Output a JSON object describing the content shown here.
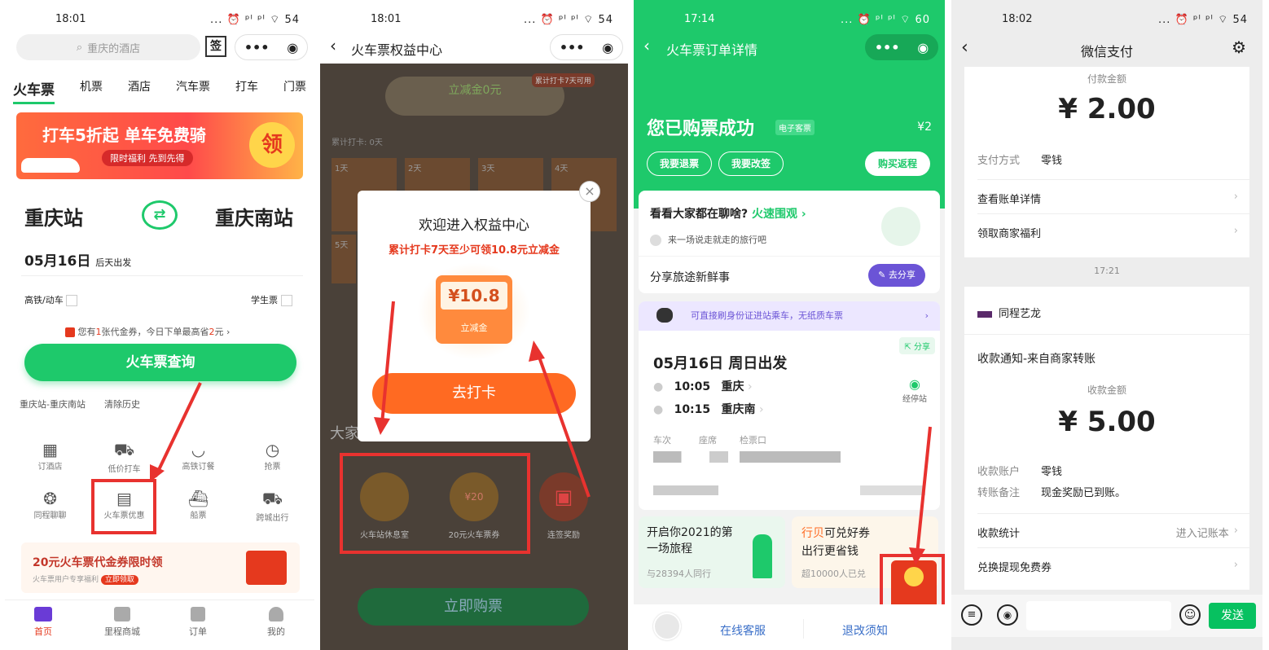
{
  "p1": {
    "time": "18:01",
    "status_icons": "... ⏰ ᵖᴵ ᵖᴵ ⌔ 54",
    "search_placeholder": "重庆的酒店",
    "sign_label": "签",
    "tabs": [
      "火车票",
      "机票",
      "酒店",
      "汽车票",
      "打车",
      "门票"
    ],
    "banner_text": "打车5折起 单车免费骑",
    "banner_sub": "限时福利 先到先得",
    "banner_badge": "领",
    "from": "重庆站",
    "to": "重庆南站",
    "date": "05月16日",
    "date_hint": "后天出发",
    "opt_gaotie": "高铁/动车",
    "opt_student": "学生票",
    "coupon_prefix": "您有",
    "coupon_count": "1",
    "coupon_mid": "张代金券，今日下单最高省",
    "coupon_amount": "2",
    "coupon_suffix": "元 ›",
    "query_button": "火车票查询",
    "history": "重庆站-重庆南站",
    "clear_history": "清除历史",
    "grid": [
      {
        "label": "订酒店"
      },
      {
        "label": "低价打车"
      },
      {
        "label": "高铁订餐"
      },
      {
        "label": "抢票"
      },
      {
        "label": "同程聊聊"
      },
      {
        "label": "火车票优惠"
      },
      {
        "label": "船票"
      },
      {
        "label": "跨城出行"
      }
    ],
    "promo_title": "20元火车票代金券限时领",
    "promo_sub": "火车票用户专享福利",
    "promo_btn": "立即领取",
    "nav": [
      "首页",
      "里程商城",
      "订单",
      "我的"
    ]
  },
  "p2": {
    "time": "18:01",
    "status_icons": "... ⏰ ᵖᴵ ᵖᴵ ⌔ 54",
    "title": "火车票权益中心",
    "bg_amount": "立减金0元",
    "bg_badge": "累计打卡7天可用",
    "bg_row": "累计打卡: 0天",
    "bg_days": [
      "1天",
      "2天",
      "3天",
      "4天",
      "5天"
    ],
    "bg_text": "大家",
    "bg_buy": "立即购票",
    "modal_title": "欢迎进入权益中心",
    "modal_sub": "累计打卡7天至少可领10.8元立减金",
    "amount": "¥10.8",
    "amount_label": "立减金",
    "modal_button": "去打卡",
    "benefits": [
      "火车站休息室",
      "20元火车票券",
      "连签奖励"
    ],
    "benefit_price": "¥20"
  },
  "p3": {
    "time": "17:14",
    "status_icons": "... ⏰ ᵖᴵ ᵖᴵ ⌔ 60",
    "title": "火车票订单详情",
    "success": "您已购票成功",
    "e_ticket": "电子客票",
    "price": "¥2",
    "btn_refund": "我要退票",
    "btn_change": "我要改签",
    "btn_return": "购买返程",
    "chat_title": "看看大家都在聊啥?",
    "chat_link": "火速围观 ›",
    "chat_sub": "来一场说走就走的旅行吧",
    "share_text": "分享旅途新鲜事",
    "share_btn": "去分享",
    "notice": "可直接刷身份证进站乘车，无纸质车票",
    "share_tag": "分享",
    "depart": "05月16日 周日出发",
    "dep_time": "10:05",
    "dep_station": "重庆",
    "arr_time": "10:15",
    "arr_station": "重庆南",
    "stops": "经停站",
    "cols": [
      "车次",
      "座席",
      "检票口"
    ],
    "card1_title": "开启你2021的第一场旅程",
    "card1_sub": "与28394人同行",
    "card2_title_a": "行贝",
    "card2_title_b": "可兑好券",
    "card2_line2": "出行更省钱",
    "card2_sub": "超10000人已兑",
    "service": "在线客服",
    "refund_notice": "退改须知"
  },
  "p4": {
    "time": "18:02",
    "status_icons": "... ⏰ ᵖᴵ ᵖᴵ ⌔ 54",
    "title": "微信支付",
    "pay_label": "付款金额",
    "pay_amount": "¥ 2.00",
    "method_label": "支付方式",
    "method_value": "零钱",
    "bill_detail": "查看账单详情",
    "merchant_benefit": "领取商家福利",
    "time2": "17:21",
    "merchant": "同程艺龙",
    "notice_title": "收款通知-来自商家转账",
    "recv_label": "收款金额",
    "recv_amount": "¥ 5.00",
    "acc_label": "收款账户",
    "acc_value": "零钱",
    "remark_label": "转账备注",
    "remark_value": "现金奖励已到账。",
    "stats": "收款统计",
    "stats_link": "进入记账本",
    "exchange": "兑换提现免费券",
    "send": "发送"
  },
  "colors": {
    "green": "#1ec96b",
    "orange": "#ff6a22",
    "annotation": "#e8322f",
    "wechat_green": "#07c160"
  }
}
